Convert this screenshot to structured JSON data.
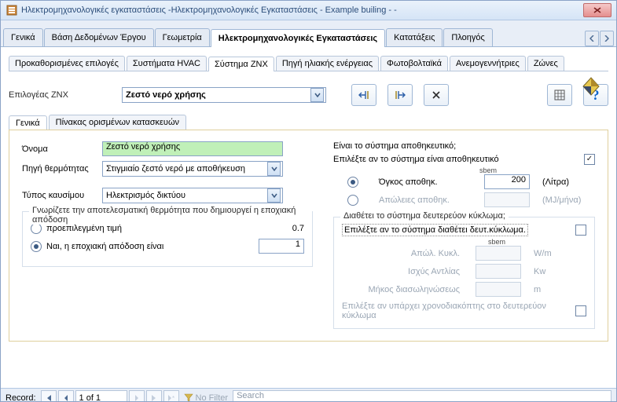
{
  "title": "Ηλεκτρομηχανολογικές εγκαταστάσεις -Ηλεκτρομηχανολογικές Εγκαταστάσεις - Example builing -  -",
  "mainTabs": [
    "Γενικά",
    "Βάση Δεδομένων Έργου",
    "Γεωμετρία",
    "Ηλεκτρομηχανολογικές Εγκαταστάσεις",
    "Κατατάξεις",
    "Πλοηγός"
  ],
  "subTabs": [
    "Προκαθορισμένες επιλογές",
    "Συστήματα HVAC",
    "Σύστημα ZNX",
    "Πηγή ηλιακής ενέργειας",
    "Φωτοβολταϊκά",
    "Ανεμογεννήτριες",
    "Ζώνες"
  ],
  "znx": {
    "optionsLabel": "Επιλογέας ZNX",
    "selected": "Ζεστό νερό χρήσης"
  },
  "innerTabs": [
    "Γενικά",
    "Πίνακας ορισμένων κατασκευών"
  ],
  "form": {
    "nameLabel": "Όνομα",
    "nameValue": "Ζεστό νερό χρήσης",
    "heatSourceLabel": "Πηγή θερμότητας",
    "heatSourceValue": "Στιγμιαίο ζεστό νερό με αποθήκευση",
    "fuelTypeLabel": "Τύπος καυσίμου",
    "fuelTypeValue": "Ηλεκτρισμός δικτύου",
    "efficiencyGroupTitle": "Γνωρίζετε την αποτελεσματική θερμότητα που δημιουργεί η εποχιακή απόδοση",
    "radioDefault": "προεπιλεγμένη τιμή",
    "radioDefaultVal": "0.7",
    "radioYes": "Ναι, η εποχιακή απόδοση είναι",
    "radioYesVal": "1"
  },
  "storage": {
    "question": "Είναι το σύστημα αποθηκευτικό;",
    "selectHint": "Επιλέξτε αν το σύστημα είναι αποθηκευτικό",
    "sbem": "sbem",
    "volLabel": "Όγκος αποθηκ.",
    "volValue": "200",
    "volUnit": "(Λίτρα)",
    "lossLabel": "Απώλειες αποθηκ.",
    "lossUnit": "(MJ/μήνα)"
  },
  "secondary": {
    "question": "Διαθέτει το σύστημα δευτερεύον κύκλωμα;",
    "selectHint": "Επιλέξτε αν το σύστημα διαθέτει δευτ.κύκλωμα.",
    "sbem": "sbem",
    "circLossLabel": "Απώλ. Κυκλ.",
    "circLossUnit": "W/m",
    "pumpLabel": "Ισχύς Αντλίας",
    "pumpUnit": "Kw",
    "pipeLenLabel": "Μήκος διασωληνώσεως",
    "pipeLenUnit": "m",
    "timerHint": "Επιλέξτε αν υπάρχει χρονοδιακόπτης στο δευτερεύον κύκλωμα"
  },
  "record": {
    "label": "Record:",
    "pos": "1 of 1",
    "noFilter": "No Filter",
    "search": "Search"
  }
}
